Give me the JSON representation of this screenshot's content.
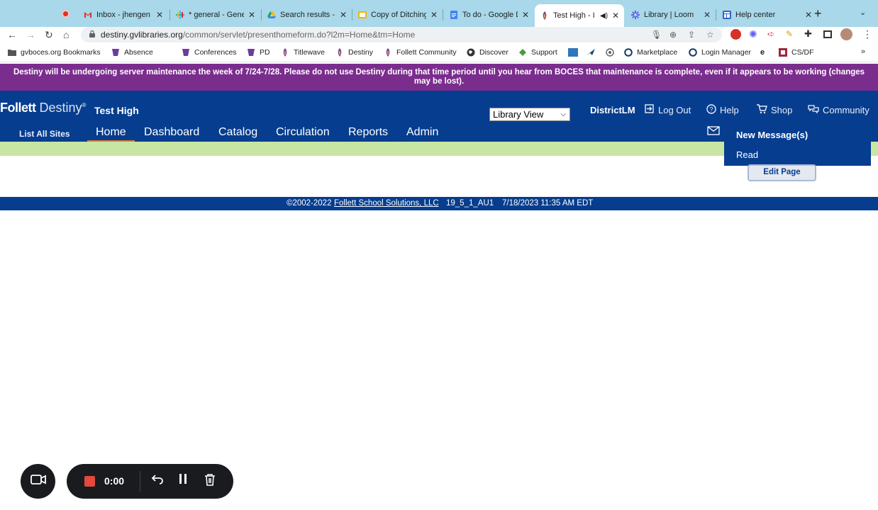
{
  "browser": {
    "tabs": [
      {
        "title": "Inbox - jhengen",
        "icon": "gmail-icon",
        "color": "#d93025"
      },
      {
        "title": "* general - Gene",
        "icon": "slack-icon",
        "color": "#e01e5a"
      },
      {
        "title": "Search results -",
        "icon": "drive-icon",
        "color": "#1fa463"
      },
      {
        "title": "Copy of Ditching",
        "icon": "slides-icon",
        "color": "#f4b400"
      },
      {
        "title": "To do - Google D",
        "icon": "docs-icon",
        "color": "#4285f4"
      },
      {
        "title": "Test High - I",
        "icon": "destiny-icon",
        "color": "#6a3ca0",
        "active": true
      },
      {
        "title": "Library | Loom",
        "icon": "loom-icon",
        "color": "#625df5"
      },
      {
        "title": "Help center",
        "icon": "help-center-icon",
        "color": "#2f63c9"
      }
    ],
    "url_host": "destiny.gvlibraries.org",
    "url_path": "/common/servlet/presenthomeform.do?l2m=Home&tm=Home",
    "bookmarks": [
      {
        "label": "gvboces.org Bookmarks",
        "icon": "folder-icon",
        "color": "#555555"
      },
      {
        "label": "Absence",
        "icon": "frontline-icon",
        "color": "#6a3ca0"
      },
      {
        "label": "Conferences",
        "icon": "frontline-icon",
        "color": "#6a3ca0"
      },
      {
        "label": "PD",
        "icon": "frontline-icon",
        "color": "#6a3ca0"
      },
      {
        "label": "Titlewave",
        "icon": "follett-icon",
        "color": "#6a3ca0"
      },
      {
        "label": "Destiny",
        "icon": "follett-icon",
        "color": "#6a3ca0"
      },
      {
        "label": "Follett Community",
        "icon": "follett-icon",
        "color": "#6a3ca0"
      },
      {
        "label": "Discover",
        "icon": "globe-icon",
        "color": "#333333"
      },
      {
        "label": "Support",
        "icon": "support-icon",
        "color": "#4b9b3e"
      },
      {
        "label": "",
        "icon": "amex-icon",
        "color": "#2e77bc"
      },
      {
        "label": "",
        "icon": "bird-icon",
        "color": "#1b4a7a"
      },
      {
        "label": "",
        "icon": "circle-logo-icon",
        "color": "#5f6368"
      },
      {
        "label": "Marketplace",
        "icon": "ring-icon",
        "color": "#173b6c"
      },
      {
        "label": "Login Manager",
        "icon": "ring-icon",
        "color": "#173b6c"
      },
      {
        "label": "",
        "icon": "e-icon",
        "color": "#111111"
      },
      {
        "label": "CS/DF",
        "icon": "csdf-icon",
        "color": "#a0263c"
      }
    ]
  },
  "banner": {
    "text": "Destiny will be undergoing server maintenance the week of 7/24-7/28. Please do not use Destiny during that time period until you hear from BOCES that maintenance is complete, even if it appears to be working (changes may be lost)."
  },
  "header": {
    "logo_follett": "Follett",
    "logo_destiny": "Destiny",
    "logo_mark": "®",
    "site_name": "Test High",
    "view_select": "Library View",
    "user": "DistrictLM",
    "links": {
      "logout": "Log Out",
      "help": "Help",
      "shop": "Shop",
      "community": "Community"
    },
    "list_all_sites": "List All Sites",
    "nav": [
      "Home",
      "Dashboard",
      "Catalog",
      "Circulation",
      "Reports",
      "Admin"
    ],
    "active_nav": "Home"
  },
  "messages_menu": {
    "new": "New Message(s)",
    "read": "Read"
  },
  "content": {
    "edit_page": "Edit Page"
  },
  "footer": {
    "copyright": "©2002-2022",
    "company": "Follett School Solutions, LLC",
    "version": "19_5_1_AU1",
    "timestamp": "7/18/2023 11:35 AM EDT"
  },
  "recorder": {
    "time": "0:00"
  },
  "colors": {
    "banner": "#7b2d8e",
    "header": "#063d8f",
    "green_bar": "#c8e6a3",
    "active_underline": "#e27a2b",
    "record_red": "#e5483c"
  }
}
